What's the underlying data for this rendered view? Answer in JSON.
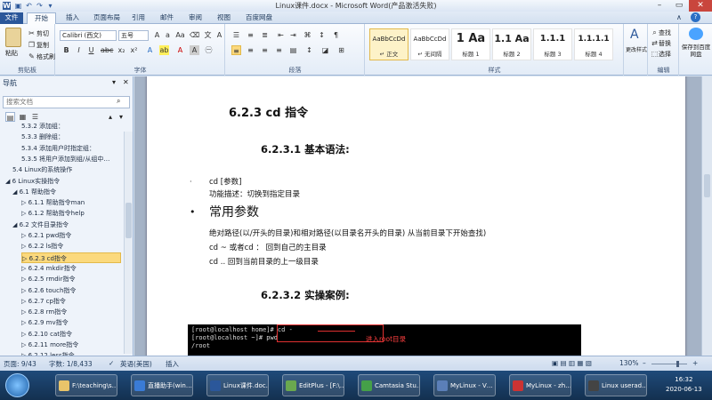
{
  "window": {
    "title": "Linux课件.docx - Microsoft Word(产品激活失败)"
  },
  "tabs": [
    "文件",
    "开始",
    "插入",
    "页面布局",
    "引用",
    "邮件",
    "审阅",
    "视图",
    "百度网盘"
  ],
  "ribbon": {
    "clipboard": {
      "label": "剪贴板",
      "paste": "粘贴",
      "cut": "剪切",
      "copy": "复制",
      "format_painter": "格式刷"
    },
    "font": {
      "label": "字体",
      "font_name": "Calibri (西文)",
      "font_size": "五号"
    },
    "paragraph": {
      "label": "段落"
    },
    "styles": {
      "label": "样式",
      "items": [
        {
          "preview": "AaBbCcDd",
          "name": "↵ 正文"
        },
        {
          "preview": "AaBbCcDd",
          "name": "↵ 无间隔"
        },
        {
          "preview": "1 Aa",
          "name": "标题 1"
        },
        {
          "preview": "1.1 Aa",
          "name": "标题 2"
        },
        {
          "preview": "1.1.1",
          "name": "标题 3"
        },
        {
          "preview": "1.1.1.1",
          "name": "标题 4"
        }
      ],
      "change": "更改样式"
    },
    "editing": {
      "label": "编辑",
      "find": "查找",
      "replace": "替换",
      "select": "选择"
    },
    "baidu": {
      "label": "保存到百度网盘"
    }
  },
  "nav": {
    "title": "导航",
    "search_placeholder": "搜索文档",
    "items": [
      {
        "text": "5.3.2 添加组：",
        "level": 3
      },
      {
        "text": "5.3.3 删除组：",
        "level": 3
      },
      {
        "text": "5.3.4 添加用户时指定组：",
        "level": 3
      },
      {
        "text": "5.3.5 将用户添加到组/从组中…",
        "level": 3
      },
      {
        "text": "5.4 Linux的系统操作",
        "level": 2
      },
      {
        "text": "◢ 6 Linux实操指令",
        "level": 1
      },
      {
        "text": "◢ 6.1 帮助指令",
        "level": 2
      },
      {
        "text": "▷ 6.1.1 帮助指令man",
        "level": 3
      },
      {
        "text": "▷ 6.1.2 帮助指令help",
        "level": 3
      },
      {
        "text": "◢ 6.2 文件目录指令",
        "level": 2
      },
      {
        "text": "▷ 6.2.1 pwd指令",
        "level": 3
      },
      {
        "text": "▷ 6.2.2 ls指令",
        "level": 3
      },
      {
        "text": "▷ 6.2.3 cd指令",
        "level": 3
      },
      {
        "text": "▷ 6.2.4 mkdir指令",
        "level": 3
      },
      {
        "text": "▷ 6.2.5 rmdir指令",
        "level": 3
      },
      {
        "text": "▷ 6.2.6 touch指令",
        "level": 3
      },
      {
        "text": "▷ 6.2.7 cp指令",
        "level": 3
      },
      {
        "text": "▷ 6.2.8 rm指令",
        "level": 3
      },
      {
        "text": "▷ 6.2.9 mv指令",
        "level": 3
      },
      {
        "text": "▷ 6.2.10 cat指令",
        "level": 3
      },
      {
        "text": "▷ 6.2.11 more指令",
        "level": 3
      },
      {
        "text": "▷ 6.2.12 less指令",
        "level": 3
      }
    ],
    "selected_index": 12
  },
  "doc": {
    "h3": "6.2.3  cd 指令",
    "h4a": "6.2.3.1      基本语法:",
    "syntax_bullet": "·",
    "syntax": "cd [参数]",
    "func": "功能描述：切换到指定目录",
    "params_bullet": "•",
    "params_title": "常用参数",
    "p1": "绝对路径(以/开头的目录)和相对路径(以目录名开头的目录) 从当前目录下开始查找)",
    "p2": "cd ~  或者cd  ：  回到自己的主目录",
    "p3": "cd ..  回到当前目录的上一级目录",
    "h4b": "6.2.3.2      实操案例:",
    "terminal": [
      "[root@localhost home]# cd -",
      "[root@localhost ~]# pwd",
      "/root"
    ],
    "annotation": "进入root目录"
  },
  "status": {
    "page": "页面: 9/43",
    "words": "字数: 1/8,433",
    "lang": "英语(美国)",
    "insert": "插入",
    "zoom": "130%"
  },
  "taskbar": {
    "items": [
      {
        "label": "F:\\teaching\\s…",
        "color": "#e8c46a"
      },
      {
        "label": "直播助手(win…",
        "color": "#3a7bd5"
      },
      {
        "label": "Linux课件.doc…",
        "color": "#2b579a"
      },
      {
        "label": "EditPlus - [F:\\…",
        "color": "#6aa84f"
      },
      {
        "label": "Camtasia Stu…",
        "color": "#45a049"
      },
      {
        "label": "MyLinux - V…",
        "color": "#5b7fb8"
      },
      {
        "label": "MyLinux - zh…",
        "color": "#cc3333"
      },
      {
        "label": "Linux userad…",
        "color": "#444444"
      }
    ],
    "time": "16:32",
    "date": "2020-06-13"
  }
}
